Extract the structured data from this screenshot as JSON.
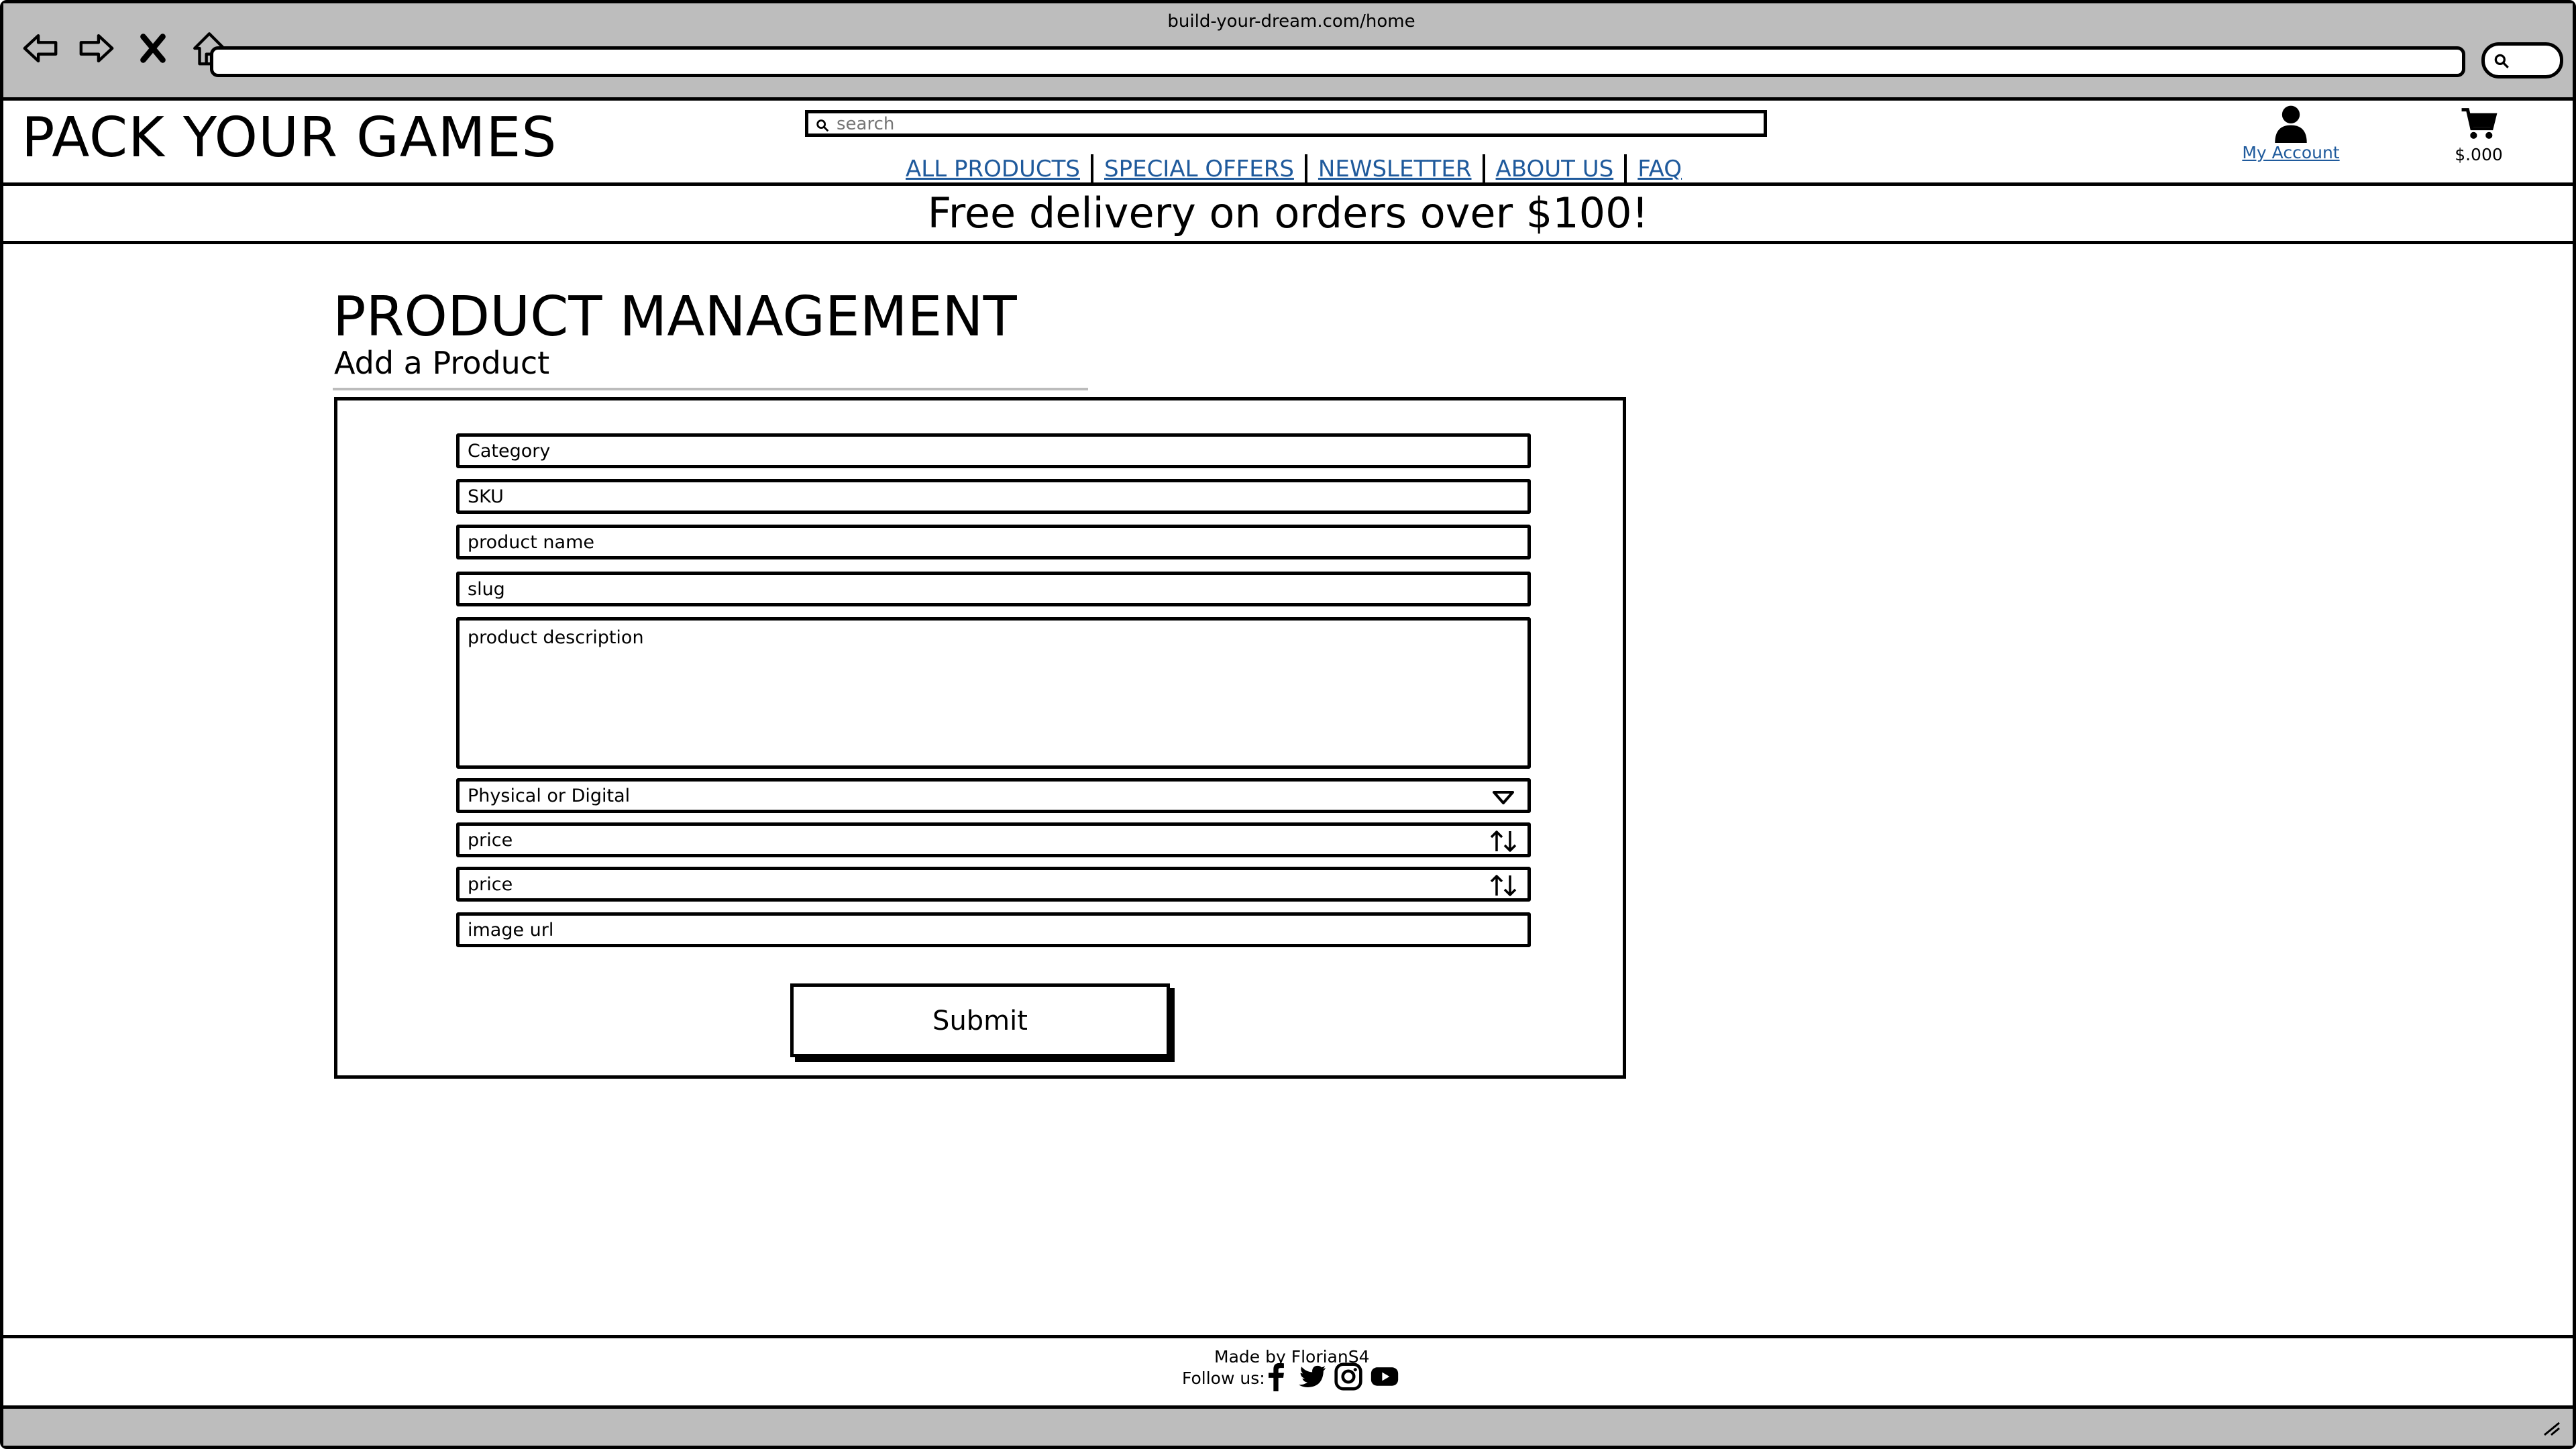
{
  "browser": {
    "url": "build-your-dream.com/home"
  },
  "header": {
    "logo": "PACK YOUR GAMES",
    "search_placeholder": "search",
    "nav": [
      "ALL PRODUCTS",
      "SPECIAL OFFERS",
      "NEWSLETTER",
      "ABOUT US",
      "FAQ"
    ],
    "account_label": "My Account",
    "cart_total": "$.000"
  },
  "promo": "Free delivery on orders over $100!",
  "main": {
    "title": "PRODUCT MANAGEMENT",
    "subtitle": "Add a Product",
    "fields": {
      "category": "Category",
      "sku": "SKU",
      "product_name": "product name",
      "slug": "slug",
      "description": "product description",
      "physical_digital": "Physical or  Digital",
      "price_1": "price",
      "price_2": "price",
      "image_url": "image url"
    },
    "submit_label": "Submit"
  },
  "footer": {
    "made_by": "Made by FlorianS4",
    "follow": "Follow us:",
    "social_icons": [
      "facebook-icon",
      "twitter-icon",
      "instagram-icon",
      "youtube-icon"
    ]
  },
  "colors": {
    "link": "#1f5a9c",
    "chrome": "#bdbdbd"
  }
}
